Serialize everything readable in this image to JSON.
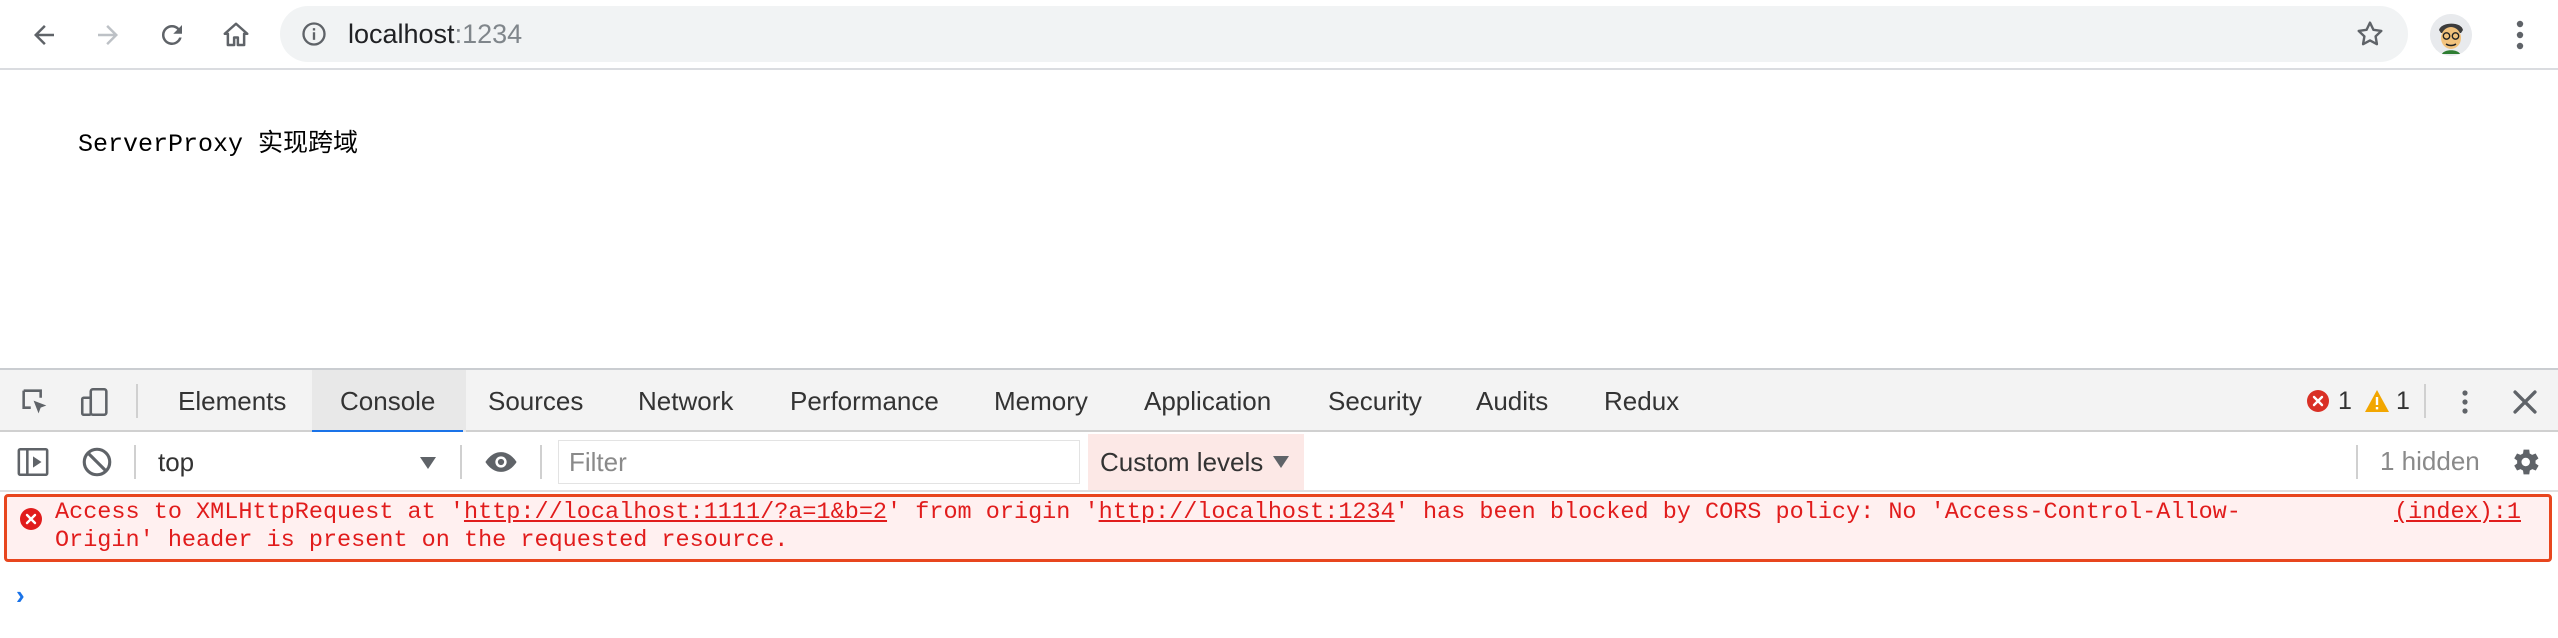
{
  "browser": {
    "url_host": "localhost",
    "url_port": ":1234",
    "buttons": [
      "back-icon",
      "forward-icon",
      "reload-icon",
      "home-icon"
    ]
  },
  "page": {
    "heading": "ServerProxy 实现跨域"
  },
  "devtools": {
    "tabs": [
      {
        "label": "Elements"
      },
      {
        "label": "Console"
      },
      {
        "label": "Sources"
      },
      {
        "label": "Network"
      },
      {
        "label": "Performance"
      },
      {
        "label": "Memory"
      },
      {
        "label": "Application"
      },
      {
        "label": "Security"
      },
      {
        "label": "Audits"
      },
      {
        "label": "Redux"
      }
    ],
    "active_tab": "Console",
    "error_count": "1",
    "warning_count": "1",
    "context": "top",
    "filter_placeholder": "Filter",
    "levels_label": "Custom levels",
    "hidden_label": "1 hidden",
    "message": {
      "part1": "Access to XMLHttpRequest at '",
      "link1": "http://localhost:1111/?a=1&b=2",
      "part2": "' from origin '",
      "link2": "http://localhost:1234",
      "part3": "' has been blocked by CORS policy: No 'Access-Control-Allow-Origin' header is present on the requested resource.",
      "source": "(index):1"
    },
    "colors": {
      "error": "#e11c1c",
      "accent": "#1a73e8"
    }
  }
}
